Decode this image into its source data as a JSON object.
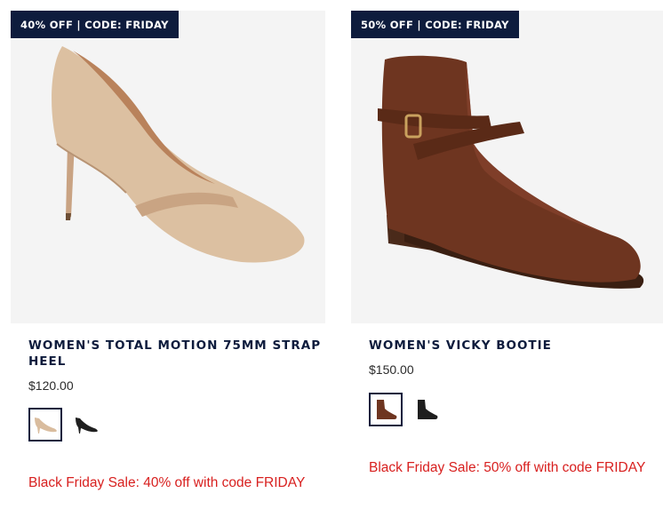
{
  "products": [
    {
      "badge": "40% OFF | CODE: FRIDAY",
      "title": "WOMEN'S TOTAL MOTION 75MM STRAP HEEL",
      "price": "$120.00",
      "swatches": [
        "nude",
        "black"
      ],
      "selected_swatch": "nude",
      "promo": "Black Friday Sale: 40% off with code FRIDAY"
    },
    {
      "badge": "50% OFF | CODE: FRIDAY",
      "title": "WOMEN'S VICKY BOOTIE",
      "price": "$150.00",
      "swatches": [
        "brown",
        "black"
      ],
      "selected_swatch": "brown",
      "promo": "Black Friday Sale: 50% off with code FRIDAY"
    }
  ],
  "colors": {
    "badge_bg": "#0e1c3d",
    "title": "#0e1c3d",
    "promo": "#d8201f",
    "image_bg": "#f4f4f4"
  }
}
